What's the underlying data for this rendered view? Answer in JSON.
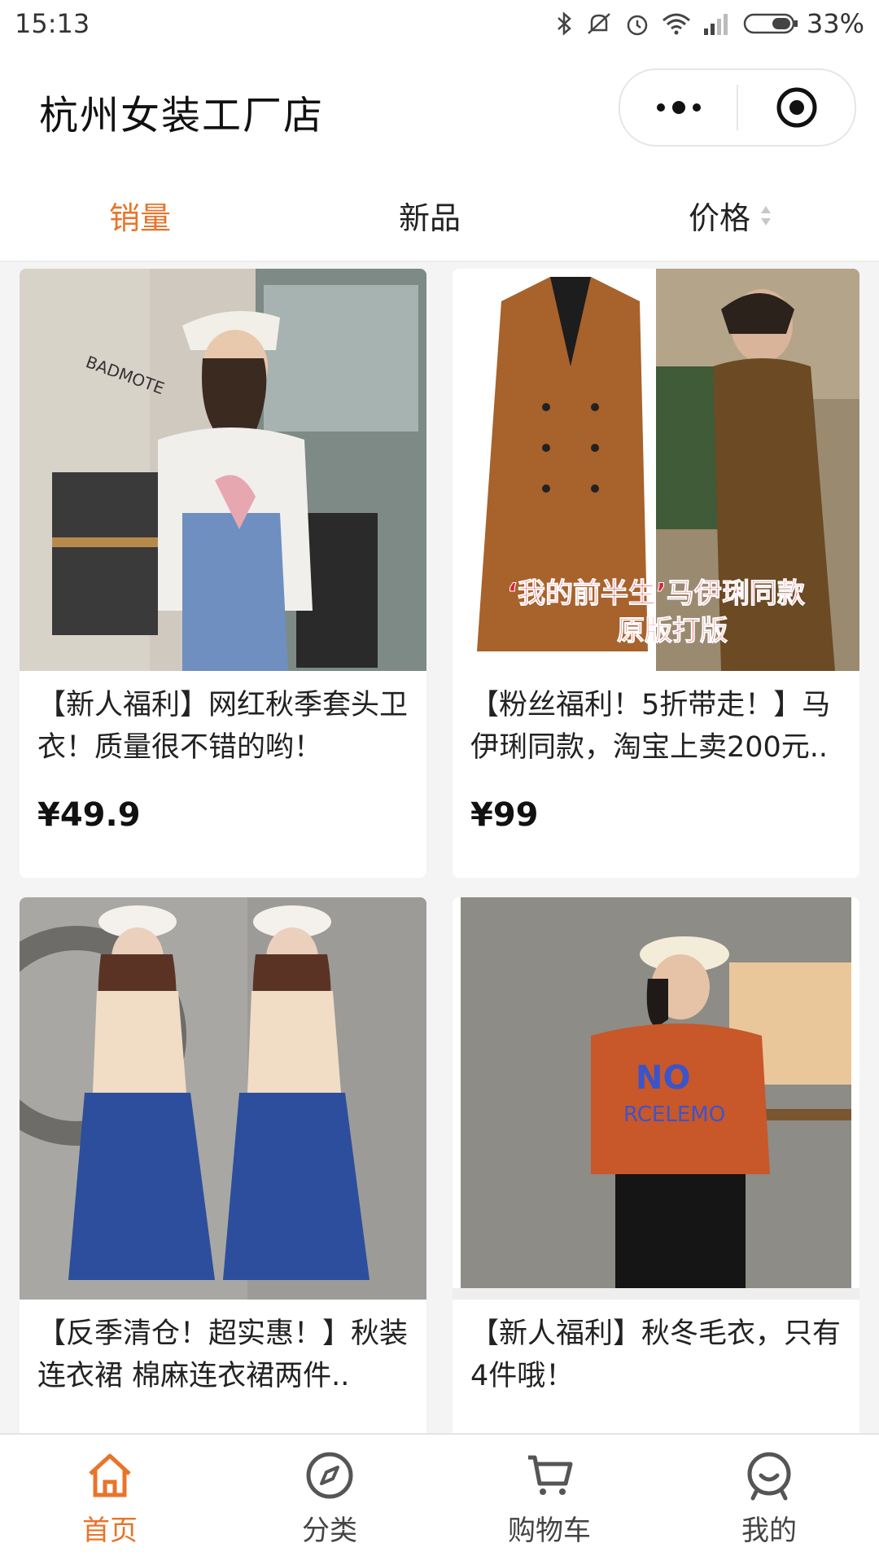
{
  "status": {
    "time": "15:13",
    "battery": "33%"
  },
  "nav": {
    "title": "杭州女装工厂店"
  },
  "tabs": {
    "sales": "销量",
    "new": "新品",
    "price": "价格"
  },
  "colors": {
    "accent": "#e8742a"
  },
  "products": [
    {
      "title": "【新人福利】网红秋季套头卫衣！质量很不错的哟！",
      "price": "¥49.9",
      "image": "white-sweatshirt-overalls-photo"
    },
    {
      "title": "【粉丝福利！5折带走！】马伊琍同款，淘宝上卖200元..",
      "price": "¥99",
      "image": "brown-suede-trench-coat-photo",
      "overlay": "‘我的前半生’马伊琍同款\n原版打版"
    },
    {
      "title": "【反季清仓！超实惠！】秋装连衣裙 棉麻连衣裙两件..",
      "price": "",
      "image": "blue-skirt-two-piece-photo"
    },
    {
      "title": "【新人福利】秋冬毛衣，只有4件哦！",
      "price": "",
      "image": "orange-knit-sweater-photo"
    }
  ],
  "tabbar": {
    "items": [
      {
        "label": "首页",
        "icon": "home-icon"
      },
      {
        "label": "分类",
        "icon": "compass-icon"
      },
      {
        "label": "购物车",
        "icon": "cart-icon"
      },
      {
        "label": "我的",
        "icon": "profile-icon"
      }
    ]
  }
}
